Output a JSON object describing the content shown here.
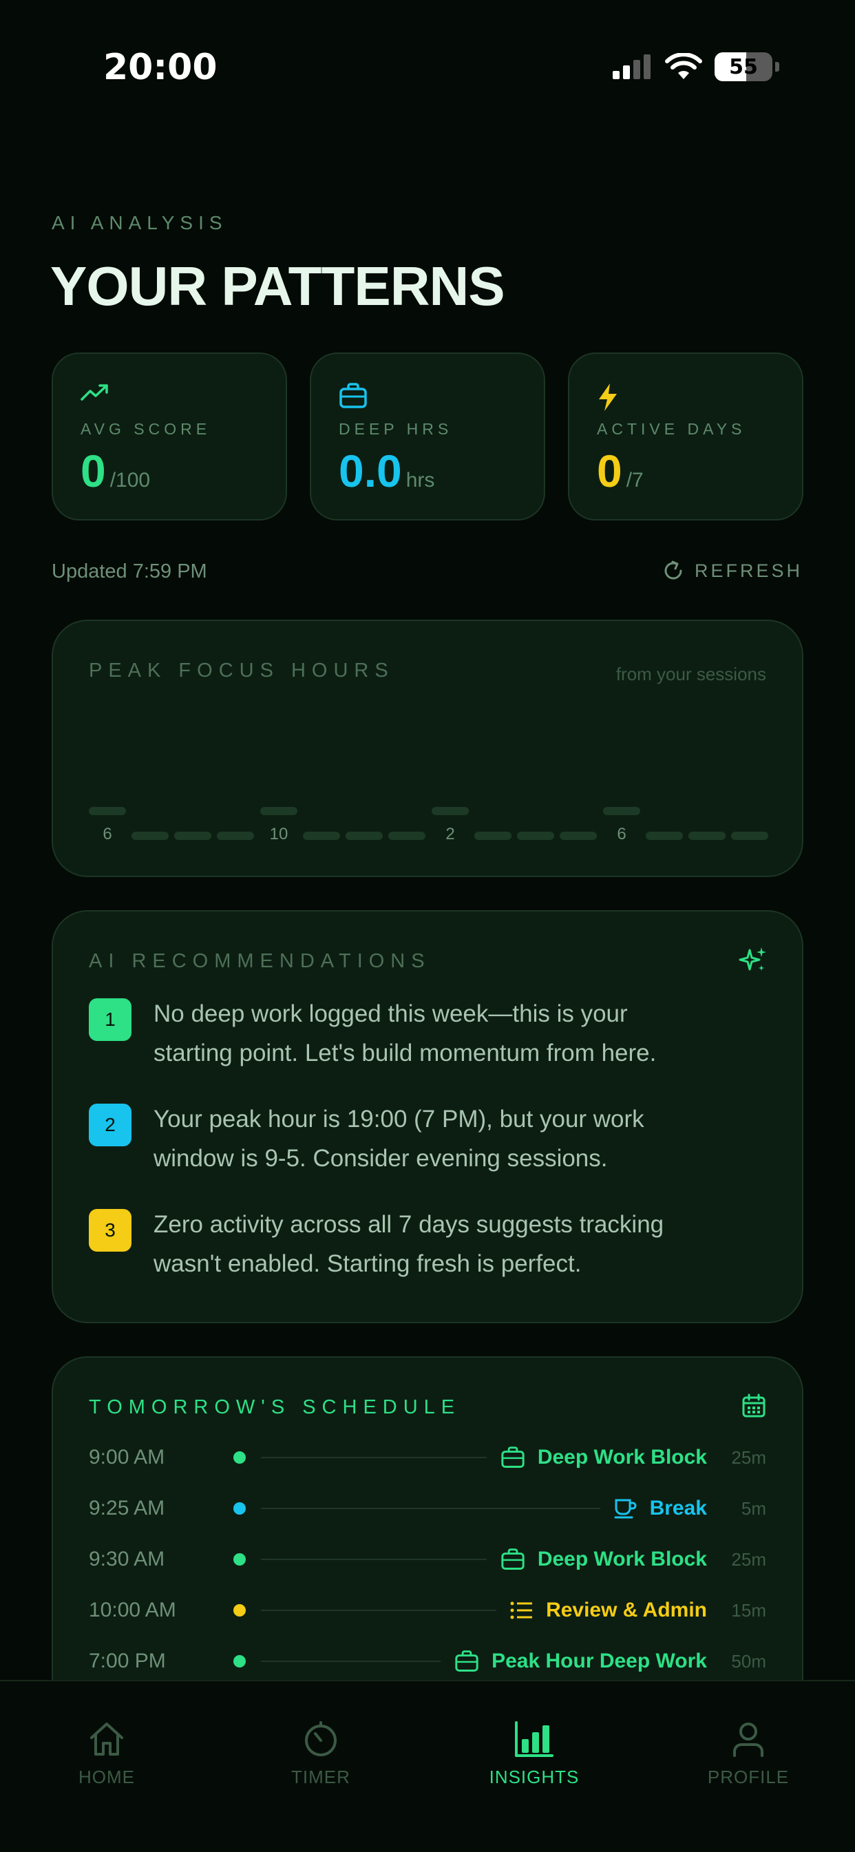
{
  "status_bar": {
    "time": "20:00",
    "battery": "55"
  },
  "header": {
    "eyebrow": "AI ANALYSIS",
    "title": "YOUR PATTERNS"
  },
  "stats": [
    {
      "label": "AVG SCORE",
      "value": "0",
      "unit": "/100",
      "icon": "trending-up-icon",
      "color": "#2ee086"
    },
    {
      "label": "DEEP HRS",
      "value": "0.0",
      "unit": "hrs",
      "icon": "briefcase-icon",
      "color": "#18c3ee"
    },
    {
      "label": "ACTIVE DAYS",
      "value": "0",
      "unit": "/7",
      "icon": "lightning-icon",
      "color": "#f5cc16"
    }
  ],
  "updated": "Updated 7:59 PM",
  "refresh_label": "REFRESH",
  "peak_focus": {
    "title": "PEAK FOCUS HOURS",
    "note": "from your sessions",
    "hour_labels": [
      "6",
      "10",
      "2",
      "6"
    ]
  },
  "recommendations": {
    "title": "AI RECOMMENDATIONS",
    "items": [
      {
        "num": "1",
        "line1": "No deep work logged this week—this is your",
        "line2": "starting point. Let's build momentum from here.",
        "color": "#2ee086"
      },
      {
        "num": "2",
        "line1": "Your peak hour is 19:00 (7 PM), but your work",
        "line2": "window is 9-5. Consider evening sessions.",
        "color": "#18c3ee"
      },
      {
        "num": "3",
        "line1": "Zero activity across all 7 days suggests tracking",
        "line2": "wasn't enabled. Starting fresh is perfect.",
        "color": "#f5cc16"
      }
    ]
  },
  "schedule": {
    "title": "TOMORROW'S SCHEDULE",
    "rows": [
      {
        "time": "9:00 AM",
        "label": "Deep Work Block",
        "duration": "25m",
        "color": "#2ee086",
        "icon": "briefcase-icon"
      },
      {
        "time": "9:25 AM",
        "label": "Break",
        "duration": "5m",
        "color": "#18c3ee",
        "icon": "coffee-icon"
      },
      {
        "time": "9:30 AM",
        "label": "Deep Work Block",
        "duration": "25m",
        "color": "#2ee086",
        "icon": "briefcase-icon"
      },
      {
        "time": "10:00 AM",
        "label": "Review & Admin",
        "duration": "15m",
        "color": "#f5cc16",
        "icon": "list-icon"
      },
      {
        "time": "7:00 PM",
        "label": "Peak Hour Deep Work",
        "duration": "50m",
        "color": "#2ee086",
        "icon": "briefcase-icon"
      }
    ]
  },
  "tabs": [
    {
      "label": "HOME",
      "icon": "home-icon",
      "active": false
    },
    {
      "label": "TIMER",
      "icon": "timer-icon",
      "active": false
    },
    {
      "label": "INSIGHTS",
      "icon": "bar-chart-icon",
      "active": true
    },
    {
      "label": "PROFILE",
      "icon": "user-icon",
      "active": false
    }
  ]
}
